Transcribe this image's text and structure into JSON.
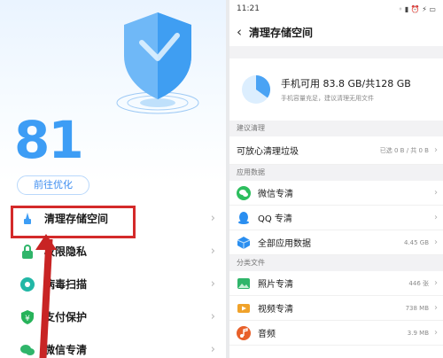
{
  "left": {
    "score": "81",
    "optimize_button": "前往优化",
    "menu": [
      {
        "label": "清理存储空间",
        "icon": "broom-icon",
        "color": "#3d9df5"
      },
      {
        "label": "权限隐私",
        "icon": "lock-icon",
        "color": "#2fb56a"
      },
      {
        "label": "病毒扫描",
        "icon": "virus-scan-icon",
        "color": "#22b7a6"
      },
      {
        "label": "支付保护",
        "icon": "payment-shield-icon",
        "color": "#27b35a"
      },
      {
        "label": "微信专清",
        "icon": "wechat-icon",
        "color": "#2fb56a"
      }
    ],
    "chevron": "›"
  },
  "right": {
    "status_time": "11:21",
    "status_icons": "◦ ▮ ⏰ ⚡ ▭",
    "title": "清理存储空间",
    "summary_main": "手机可用 83.8 GB/共128 GB",
    "summary_sub": "手机容量充足，建议清理无用文件",
    "pie_used_fraction": 0.35,
    "section_suggest": "建议清理",
    "row_safe_clean": {
      "label": "可放心清理垃圾",
      "value": "已选 0 B / 共 0 B"
    },
    "section_app": "应用数据",
    "row_wechat": {
      "label": "微信专清",
      "icon": "wechat-icon",
      "color": "#2dbe5e"
    },
    "row_qq": {
      "label": "QQ 专清",
      "icon": "qq-icon",
      "color": "#2a8ef0"
    },
    "row_all_apps": {
      "label": "全部应用数据",
      "value": "4.45 GB",
      "icon": "cube-icon",
      "color": "#2a8ef0"
    },
    "section_files": "分类文件",
    "row_photos": {
      "label": "照片专清",
      "value": "446 张",
      "icon": "photo-icon",
      "color": "#2fb56a"
    },
    "row_videos": {
      "label": "视频专清",
      "value": "738 MB",
      "icon": "video-icon",
      "color": "#f0a22a"
    },
    "row_audio": {
      "label": "音频",
      "value": "3.9 MB",
      "icon": "audio-icon",
      "color": "#e8602a"
    },
    "chevron": "›"
  }
}
